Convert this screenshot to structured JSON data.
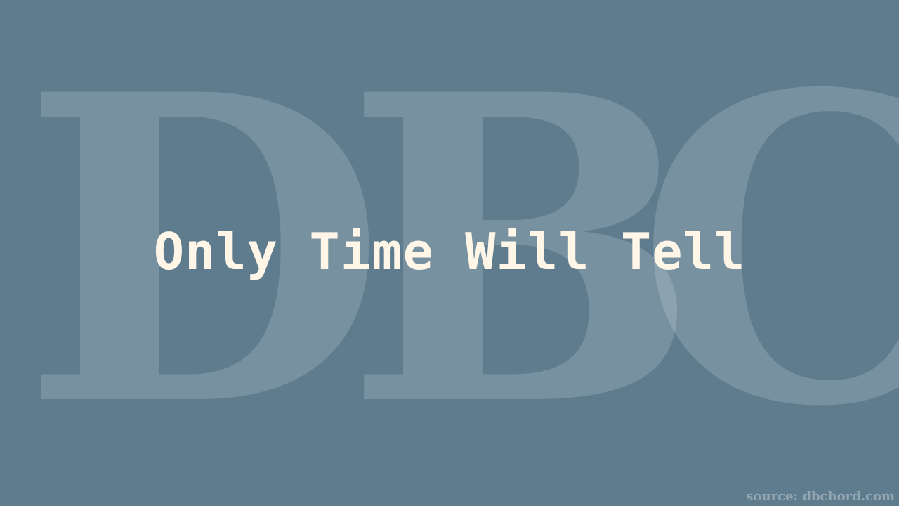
{
  "background": {
    "color": "#5f7c8e",
    "watermark_letters": [
      "D",
      "B",
      "C"
    ]
  },
  "title": "Only Time Will Tell",
  "title_color": "#fff6e8",
  "source_text": "source: dbchord.com"
}
